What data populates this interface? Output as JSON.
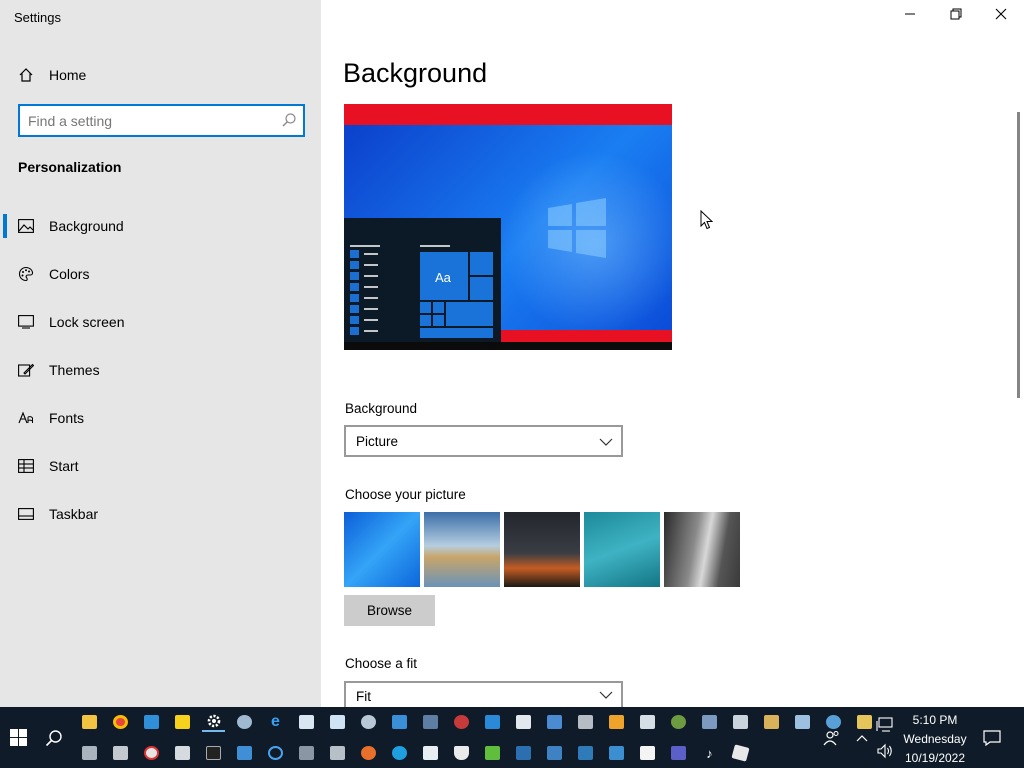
{
  "window": {
    "title": "Settings",
    "controls": {
      "minimize": "minimize-icon",
      "restore": "restore-icon",
      "close": "close-icon"
    }
  },
  "sidebar": {
    "home_label": "Home",
    "search_placeholder": "Find a setting",
    "section_title": "Personalization",
    "items": [
      {
        "label": "Background",
        "icon": "picture-icon",
        "active": true
      },
      {
        "label": "Colors",
        "icon": "palette-icon",
        "active": false
      },
      {
        "label": "Lock screen",
        "icon": "lock-screen-icon",
        "active": false
      },
      {
        "label": "Themes",
        "icon": "themes-icon",
        "active": false
      },
      {
        "label": "Fonts",
        "icon": "fonts-icon",
        "active": false
      },
      {
        "label": "Start",
        "icon": "start-icon",
        "active": false
      },
      {
        "label": "Taskbar",
        "icon": "taskbar-icon",
        "active": false
      }
    ]
  },
  "main": {
    "title": "Background",
    "preview": {
      "tile_text": "Aa"
    },
    "background_label": "Background",
    "background_value": "Picture",
    "choose_picture_label": "Choose your picture",
    "browse_label": "Browse",
    "choose_fit_label": "Choose a fit",
    "fit_value": "Fit"
  },
  "taskbar": {
    "time": "5:10 PM",
    "day": "Wednesday",
    "date": "10/19/2022"
  },
  "colors": {
    "accent": "#0078d4",
    "sidebar_bg": "#e6e6e6",
    "taskbar_bg": "#101b29",
    "preview_red": "#e81123"
  }
}
